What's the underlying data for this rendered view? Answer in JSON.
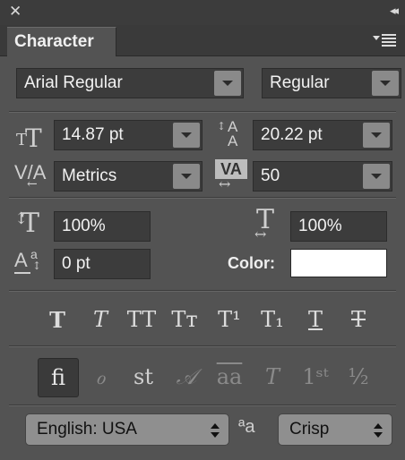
{
  "panel": {
    "title": "Character",
    "close_glyph": "✕",
    "collapse_glyph": "◂◂"
  },
  "font": {
    "family": "Arial Regular",
    "style": "Regular"
  },
  "metrics": {
    "size": "14.87 pt",
    "leading": "20.22 pt",
    "kerning": "Metrics",
    "tracking": "50"
  },
  "scale": {
    "vertical": "100%",
    "horizontal": "100%",
    "baseline_shift": "0 pt",
    "color_label": "Color:",
    "color_value": "#ffffff"
  },
  "style_buttons": [
    {
      "name": "faux-bold-button",
      "glyph": "T"
    },
    {
      "name": "faux-italic-button",
      "glyph": "T"
    },
    {
      "name": "all-caps-button",
      "glyph": "TT"
    },
    {
      "name": "small-caps-button",
      "glyph": "Tт"
    },
    {
      "name": "superscript-button",
      "glyph": "T¹"
    },
    {
      "name": "subscript-button",
      "glyph": "T₁"
    },
    {
      "name": "underline-button",
      "glyph": "T"
    },
    {
      "name": "strikethrough-button",
      "glyph": "T"
    }
  ],
  "opentype_buttons": [
    {
      "name": "ligatures-button",
      "glyph": "fi"
    },
    {
      "name": "discretionary-ligatures-button",
      "glyph": "ℴ"
    },
    {
      "name": "swash-button",
      "glyph": "st"
    },
    {
      "name": "contextual-alternates-button",
      "glyph": "𝒜"
    },
    {
      "name": "stylistic-alternates-button",
      "glyph": "aa"
    },
    {
      "name": "titling-alternates-button",
      "glyph": "T"
    },
    {
      "name": "ordinals-button",
      "glyph": "1ˢᵗ"
    },
    {
      "name": "fractions-button",
      "glyph": "½"
    }
  ],
  "footer": {
    "language": "English: USA",
    "aa_glyph": "ªa",
    "antialias": "Crisp"
  }
}
